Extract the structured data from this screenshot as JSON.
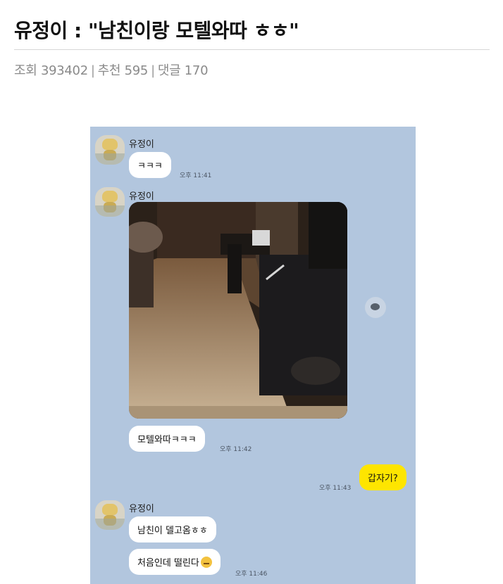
{
  "post": {
    "title": "유정이 : \"남친이랑 모텔와따 ㅎㅎ\"",
    "views_label": "조회",
    "views": "393402",
    "recommend_label": "추천",
    "recommend": "595",
    "comments_label": "댓글",
    "comments": "170",
    "separator": "|"
  },
  "chat": {
    "background": "#b2c6de",
    "sender_name": "유정이",
    "messages": [
      {
        "from": "other",
        "text": "ㅋㅋㅋ",
        "time": "오후 11:41"
      },
      {
        "from": "other",
        "type": "photo",
        "alt": "photo-of-motel-room"
      },
      {
        "from": "other",
        "text": "모텔와따ㅋㅋㅋ",
        "time": "오후 11:42"
      },
      {
        "from": "me",
        "text": "갑자기?",
        "time": "오후 11:43"
      },
      {
        "from": "other",
        "text": "남친이 델고옴ㅎㅎ",
        "time": ""
      },
      {
        "from": "other",
        "text": "처음인데 떨린다",
        "emoji": "grimace-face",
        "time": "오후 11:46"
      }
    ]
  }
}
